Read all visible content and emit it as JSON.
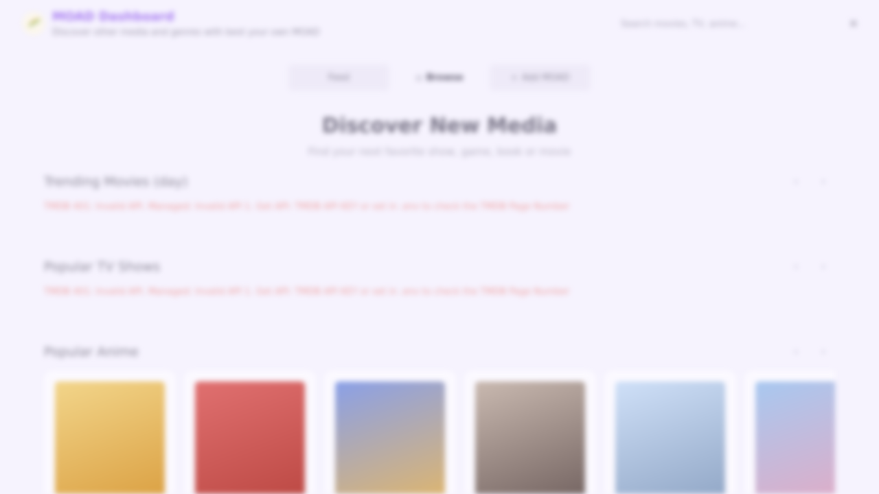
{
  "header": {
    "title": "MOAD Dashboard",
    "subtitle": "Discover other media and genres with best your own MOAD",
    "search_placeholder": "Search movies, TV, anime...",
    "close_glyph": "✕"
  },
  "tabs": [
    {
      "label": "Feed",
      "icon": ""
    },
    {
      "label": "Browse",
      "icon": "◇"
    },
    {
      "label": "Add MOAD",
      "icon": "+"
    }
  ],
  "hero": {
    "title": "Discover New Media",
    "subtitle": "Find your next favorite show, game, book or movie"
  },
  "sections": [
    {
      "title": "Trending Movies (day)",
      "error": "TMDB 401: Invalid API. Managed: Invalid API 1. Get API: TMDB API KEY or set in .env to check the TMDB Page Number"
    },
    {
      "title": "Popular TV Shows",
      "error": "TMDB 401: Invalid API. Managed: Invalid API 1. Get API: TMDB API KEY or set in .env to check the TMDB Page Number"
    },
    {
      "title": "Popular Anime",
      "error": ""
    }
  ],
  "arrows": {
    "prev": "‹",
    "next": "›"
  },
  "anime_posters": [
    {
      "colors": [
        "#f2d58a",
        "#d89a3a"
      ]
    },
    {
      "colors": [
        "#e07070",
        "#b8443e"
      ]
    },
    {
      "colors": [
        "#8aa0e8",
        "#e8b860"
      ]
    },
    {
      "colors": [
        "#c9b9b0",
        "#6a5a58"
      ]
    },
    {
      "colors": [
        "#cfe0f8",
        "#8aa0c0"
      ]
    },
    {
      "colors": [
        "#a8c8f0",
        "#e8a8c0"
      ]
    }
  ]
}
